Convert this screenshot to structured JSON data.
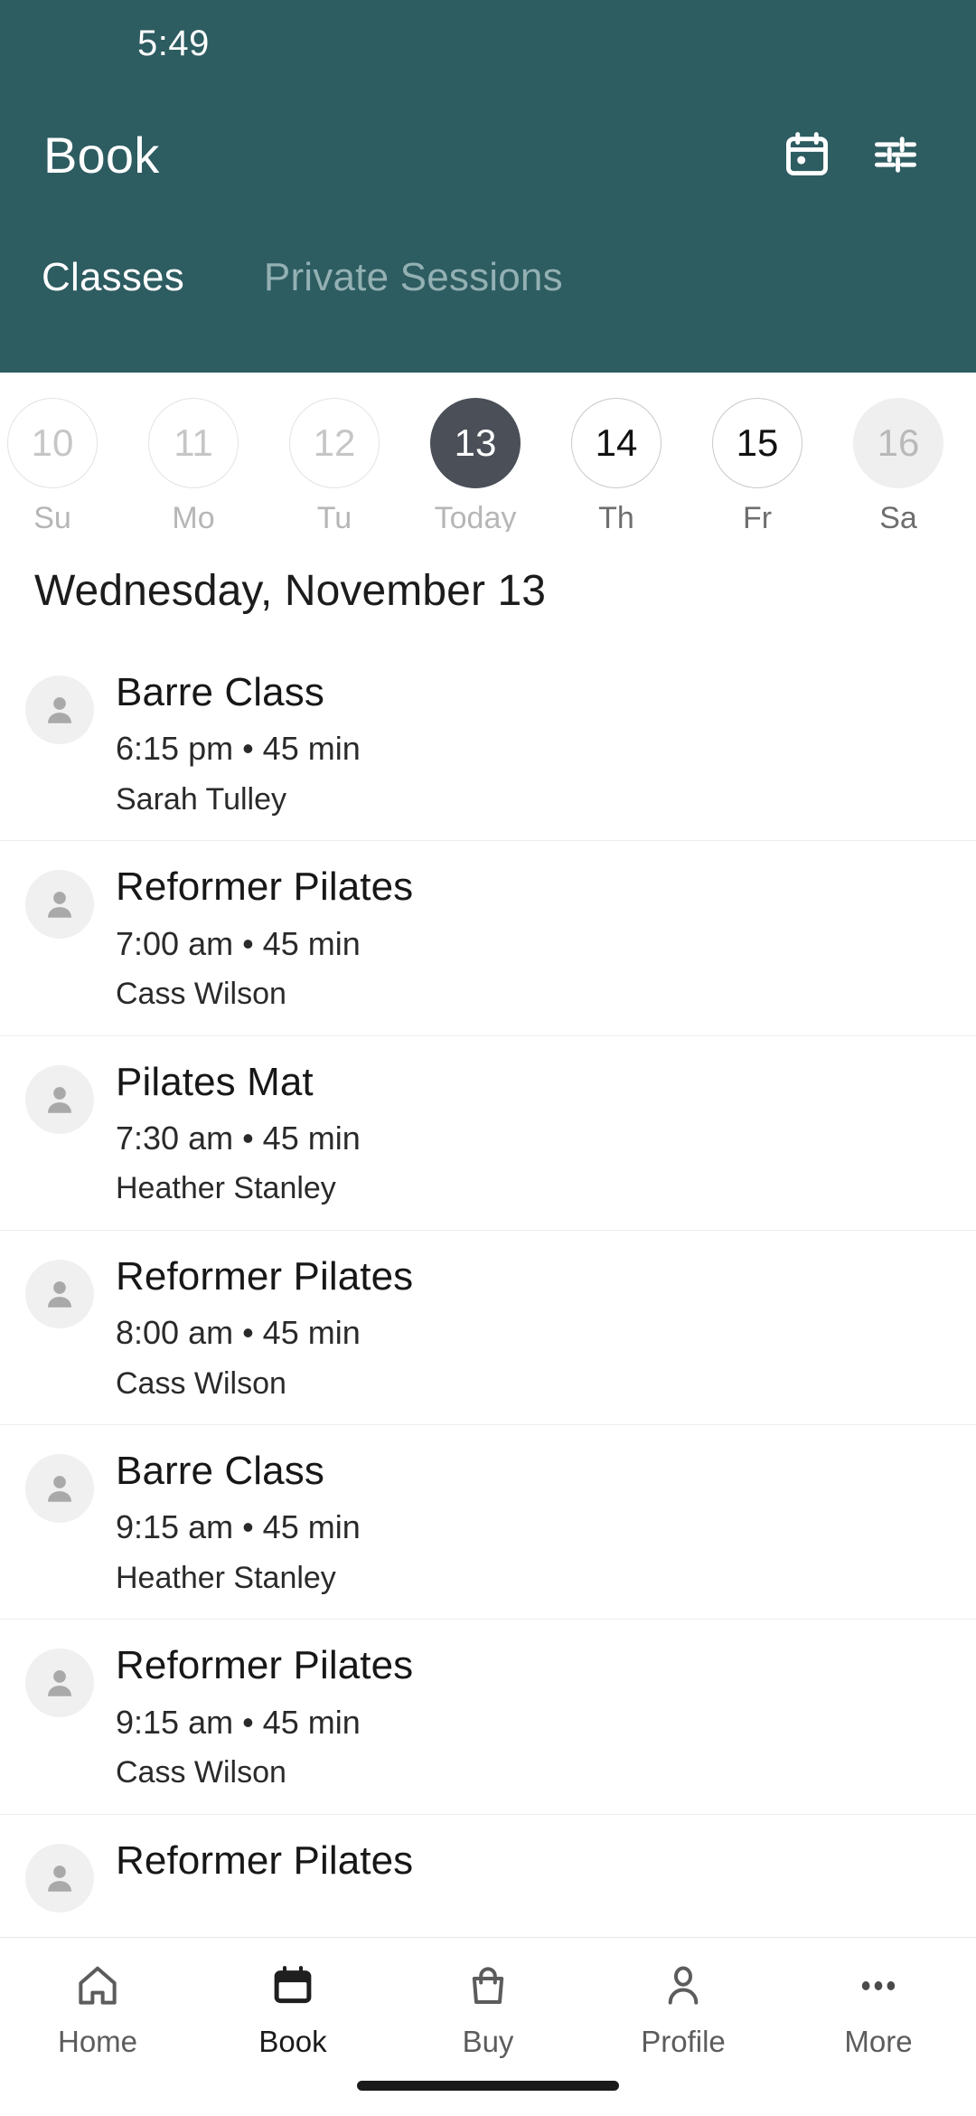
{
  "status_bar": {
    "time": "5:49"
  },
  "header": {
    "title": "Book",
    "background_color": "#2D5C61",
    "actions": [
      {
        "name": "calendar-icon",
        "label": "Calendar"
      },
      {
        "name": "filter-icon",
        "label": "Filters"
      }
    ],
    "tabs": [
      {
        "label": "Classes",
        "active": true
      },
      {
        "label": "Private Sessions",
        "active": false
      }
    ]
  },
  "date_strip": {
    "selected_color": "#4A4F58",
    "days": [
      {
        "date": "10",
        "label": "Su",
        "state": "past"
      },
      {
        "date": "11",
        "label": "Mo",
        "state": "past"
      },
      {
        "date": "12",
        "label": "Tu",
        "state": "past"
      },
      {
        "date": "13",
        "label": "Today",
        "state": "selected"
      },
      {
        "date": "14",
        "label": "Th",
        "state": "future"
      },
      {
        "date": "15",
        "label": "Fr",
        "state": "future"
      },
      {
        "date": "16",
        "label": "Sa",
        "state": "edge"
      }
    ]
  },
  "section": {
    "date_heading": "Wednesday, November 13"
  },
  "classes": [
    {
      "title": "Barre Class",
      "meta": "6:15 pm • 45 min",
      "instructor": "Sarah Tulley"
    },
    {
      "title": "Reformer Pilates",
      "meta": "7:00 am • 45 min",
      "instructor": "Cass Wilson"
    },
    {
      "title": "Pilates Mat",
      "meta": "7:30 am • 45 min",
      "instructor": "Heather Stanley"
    },
    {
      "title": "Reformer Pilates",
      "meta": "8:00 am • 45 min",
      "instructor": "Cass Wilson"
    },
    {
      "title": "Barre Class",
      "meta": "9:15 am • 45 min",
      "instructor": "Heather Stanley"
    },
    {
      "title": "Reformer Pilates",
      "meta": "9:15 am • 45 min",
      "instructor": "Cass Wilson"
    },
    {
      "title": "Reformer Pilates",
      "meta": "",
      "instructor": ""
    }
  ],
  "bottom_nav": {
    "items": [
      {
        "label": "Home",
        "icon": "home-icon",
        "active": false
      },
      {
        "label": "Book",
        "icon": "calendar-icon",
        "active": true
      },
      {
        "label": "Buy",
        "icon": "bag-icon",
        "active": false
      },
      {
        "label": "Profile",
        "icon": "person-icon",
        "active": false
      },
      {
        "label": "More",
        "icon": "more-icon",
        "active": false
      }
    ]
  }
}
